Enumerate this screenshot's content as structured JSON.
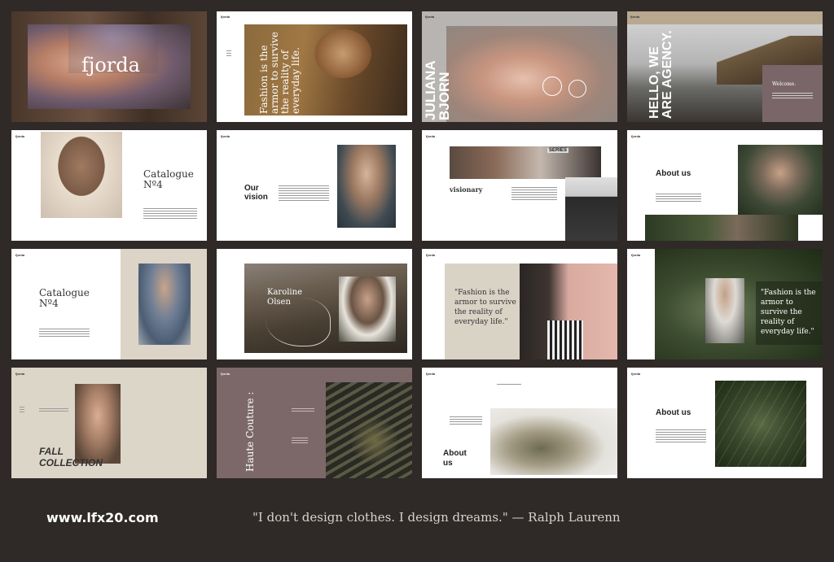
{
  "footer": {
    "url": "www.lfx20.com",
    "quote": "\"I don't design clothes. I design dreams.\" — Ralph Laurenn"
  },
  "slides": {
    "s1": {
      "brand": "fjorda"
    },
    "s2": {
      "logo": "fjorda",
      "quote": "Fashion is the armor to survive the reality of everyday life."
    },
    "s3": {
      "logo": "fjorda",
      "name_line1": "JULIANA",
      "name_line2": "BJORN"
    },
    "s4": {
      "logo": "fjorda",
      "headline": "HELLO, WE ARE AGENCY.",
      "welcome": "Welcome."
    },
    "s5": {
      "logo": "fjorda",
      "title_line1": "Catalogue",
      "title_line2": "Nº4"
    },
    "s6": {
      "logo": "fjorda",
      "title_line1": "Our",
      "title_line2": "vision"
    },
    "s7": {
      "logo": "fjorda",
      "title": "visionary",
      "sign": "SERIES"
    },
    "s8": {
      "logo": "fjorda",
      "title": "About us"
    },
    "s9": {
      "logo": "fjorda",
      "title_line1": "Catalogue",
      "title_line2": "Nº4"
    },
    "s10": {
      "name_line1": "Karoline",
      "name_line2": "Olsen"
    },
    "s11": {
      "logo": "fjorda",
      "quote": "\"Fashion is the armor to survive the reality of everyday life.\""
    },
    "s12": {
      "logo": "fjorda",
      "quote": "\"Fashion is the armor to survive the reality of everyday life.\""
    },
    "s13": {
      "logo": "fjorda",
      "title_line1": "FALL",
      "title_line2": "COLLECTION"
    },
    "s14": {
      "logo": "fjorda",
      "title": "Haute Couture :"
    },
    "s15": {
      "logo": "fjorda",
      "title_line1": "About",
      "title_line2": "us"
    },
    "s16": {
      "logo": "fjorda",
      "title": "About us"
    }
  }
}
